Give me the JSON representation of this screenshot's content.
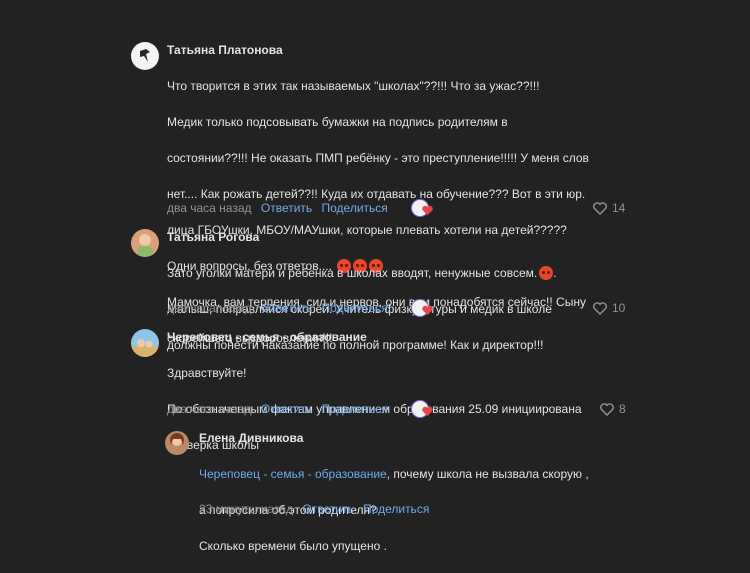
{
  "comments": [
    {
      "author": "Татьяна Платонова",
      "text_lines": [
        "Что творится в этих так называемых \"школах\"??!!! Что за ужас??!!!",
        "Медик только подсовывать бумажки на подпись родителям в",
        "состоянии??!!! Не оказать ПМП ребёнку - это преступление!!!!! У меня слов",
        "нет.... Как рожать детей??!! Куда их отдавать на обучение??? Вот в эти юр.",
        "лица ГБОУшки, МБОУ/МАУшки, которые плевать хотели на детей?????",
        "Одни вопросы, без ответов....",
        "Мамочка, вам терпения, сил и нервов, они вам понадобятся сейчас!! Сыну",
        "скорейшего выздоровления!!!"
      ],
      "time": "два часа назад",
      "reply_label": "Ответить",
      "share_label": "Поделиться",
      "likes": "14"
    },
    {
      "author": "Татьяна Рогова",
      "text_lines": [
        "Зато уголки матери и ребенка в школах вводят, ненужные совсем.",
        "Малыш, поправляйся скорей. Учитель физкультуры и медик в школе",
        "должны понести наказание по полной программе! Как и директор!!!"
      ],
      "time": "два часа назад",
      "reply_label": "Ответить",
      "share_label": "Поделиться",
      "likes": "10"
    },
    {
      "author": "Череповец - семья - образование",
      "text_lines": [
        "Здравствуйте!",
        "По обозначенным фактам управлением образования 25.09 инициирована",
        "проверка школы"
      ],
      "time": "два часа назад",
      "reply_label": "Ответить",
      "share_label": "Поделиться",
      "likes": "8"
    },
    {
      "author": "Елена Дивникова",
      "mention": "Череповец - семья - образование",
      "text_first_rest": ", почему школа не вызвала скорую ,",
      "text_lines": [
        "а попросила об этом родителя?",
        "Сколько времени было упущено ."
      ],
      "time": "23 минуты назад",
      "reply_label": "Ответить",
      "share_label": "Поделиться"
    }
  ],
  "icons": {
    "angry_emoji": "angry-face-icon",
    "heart": "heart-icon",
    "reaction": "reaction-icon"
  },
  "colors": {
    "background": "#222222",
    "link": "#71aaeb",
    "muted": "#939393",
    "text": "#e1e3e6"
  }
}
